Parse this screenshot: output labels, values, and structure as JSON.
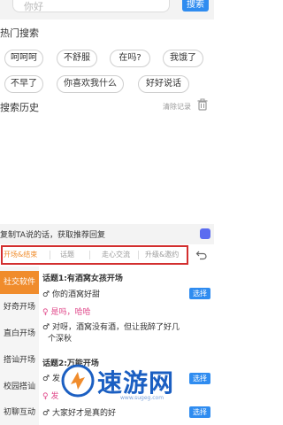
{
  "search": {
    "placeholder": "你好",
    "button": "搜索"
  },
  "hot": {
    "title": "热门搜索",
    "tags": [
      "呵呵呵",
      "不舒服",
      "在吗?",
      "我饿了",
      "不早了",
      "你喜欢我什么",
      "好好说话"
    ]
  },
  "history": {
    "title": "搜索历史",
    "clear": "清除记录"
  },
  "tip": "复制TA说的话，获取推荐回复",
  "tabs": [
    "开场&结束",
    "话题",
    "走心交流",
    "升级&邀约"
  ],
  "categories": [
    "社交软件",
    "好奇开场",
    "直白开场",
    "搭讪开场",
    "校园搭讪",
    "初聊互动"
  ],
  "topics": [
    {
      "title": "话题1:有酒窝女孩开场",
      "lines": [
        {
          "gender": "♂",
          "text": "你的酒窝好甜"
        },
        {
          "gender": "♀",
          "text": "是吗，哈哈"
        },
        {
          "gender": "♂",
          "text": "对呀，酒窝没有酒，但让我醉了好几"
        },
        {
          "gender": "",
          "text": "个深秋"
        }
      ],
      "select": "选择"
    },
    {
      "title": "话题2:万能开场",
      "lines": [
        {
          "gender": "♂",
          "text": "发"
        },
        {
          "gender": "♀",
          "text": "发"
        },
        {
          "gender": "♂",
          "text": "大家好才是真的好"
        }
      ],
      "select": "选择"
    }
  ],
  "watermark": {
    "text": "速游网",
    "url": "www.sugeg.com"
  },
  "colors": {
    "accent": "#f08c2c",
    "primary": "#2f8cf0",
    "highlight_border": "#d32f2f",
    "female": "#e0488a"
  }
}
